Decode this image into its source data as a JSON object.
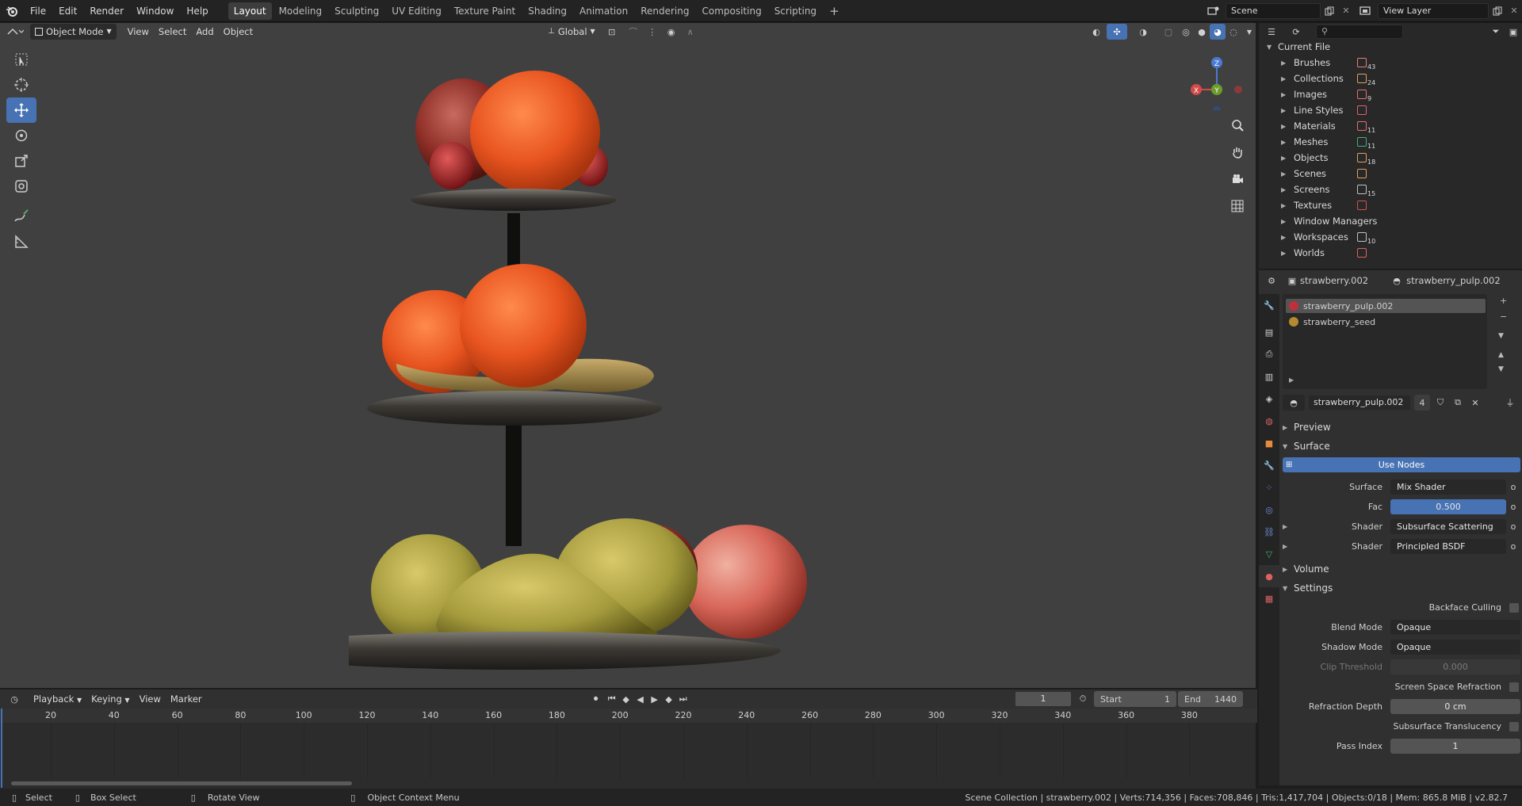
{
  "topbar": {
    "menus": [
      "File",
      "Edit",
      "Render",
      "Window",
      "Help"
    ],
    "workspaces": [
      "Layout",
      "Modeling",
      "Sculpting",
      "UV Editing",
      "Texture Paint",
      "Shading",
      "Animation",
      "Rendering",
      "Compositing",
      "Scripting"
    ],
    "active_workspace": "Layout",
    "add_tab": "+",
    "scene_name": "Scene",
    "view_layer": "View Layer"
  },
  "viewport": {
    "mode": "Object Mode",
    "menus": [
      "View",
      "Select",
      "Add",
      "Object"
    ],
    "transform_orientation": "Global",
    "gizmo": {
      "z": "Z",
      "y": "Y",
      "x": "X"
    }
  },
  "outliner": {
    "root": "Current File",
    "search_placeholder": "",
    "items": [
      {
        "label": "Brushes",
        "count": "43"
      },
      {
        "label": "Collections",
        "count": "24"
      },
      {
        "label": "Images",
        "count": "9"
      },
      {
        "label": "Line Styles",
        "count": ""
      },
      {
        "label": "Materials",
        "count": "11"
      },
      {
        "label": "Meshes",
        "count": "11"
      },
      {
        "label": "Objects",
        "count": "18"
      },
      {
        "label": "Scenes",
        "count": ""
      },
      {
        "label": "Screens",
        "count": "15"
      },
      {
        "label": "Textures",
        "count": ""
      },
      {
        "label": "Window Managers",
        "count": ""
      },
      {
        "label": "Workspaces",
        "count": "10"
      },
      {
        "label": "Worlds",
        "count": ""
      }
    ]
  },
  "properties": {
    "breadcrumb_object": "strawberry.002",
    "breadcrumb_material": "strawberry_pulp.002",
    "material_slots": [
      "strawberry_pulp.002",
      "strawberry_seed"
    ],
    "material_name": "strawberry_pulp.002",
    "user_count": "4",
    "panels": {
      "preview": "Preview",
      "surface": "Surface",
      "volume": "Volume",
      "settings": "Settings"
    },
    "use_nodes": "Use Nodes",
    "surface_rows": [
      {
        "label": "Surface",
        "value": "Mix Shader"
      },
      {
        "label": "Fac",
        "value": "0.500"
      },
      {
        "label": "Shader",
        "value": "Subsurface Scattering"
      },
      {
        "label": "Shader",
        "value": "Principled BSDF"
      }
    ],
    "settings": {
      "backface_culling": "Backface Culling",
      "blend_mode_label": "Blend Mode",
      "blend_mode": "Opaque",
      "shadow_mode_label": "Shadow Mode",
      "shadow_mode": "Opaque",
      "clip_threshold_label": "Clip Threshold",
      "clip_threshold": "0.000",
      "ssr_label": "Screen Space Refraction",
      "refraction_depth_label": "Refraction Depth",
      "refraction_depth": "0 cm",
      "sss_translucency_label": "Subsurface Translucency",
      "pass_index_label": "Pass Index",
      "pass_index": "1"
    }
  },
  "timeline": {
    "menus": [
      "Playback",
      "Keying",
      "View",
      "Marker"
    ],
    "current_frame": "1",
    "start_label": "Start",
    "start": "1",
    "end_label": "End",
    "end": "1440",
    "ticks": [
      "20",
      "40",
      "60",
      "80",
      "100",
      "120",
      "140",
      "160",
      "180",
      "200",
      "220",
      "240",
      "260",
      "280",
      "300",
      "320",
      "340",
      "360",
      "380"
    ]
  },
  "status": {
    "select": "Select",
    "box_select": "Box Select",
    "rotate_view": "Rotate View",
    "context_menu": "Object Context Menu",
    "stats": "Scene Collection | strawberry.002 | Verts:714,356 | Faces:708,846 | Tris:1,417,704 | Objects:0/18 | Mem: 865.8 MiB | v2.82.7"
  },
  "colors": {
    "accent": "#4772b3",
    "viewport_bg": "#404040",
    "panel_bg": "#303030"
  }
}
